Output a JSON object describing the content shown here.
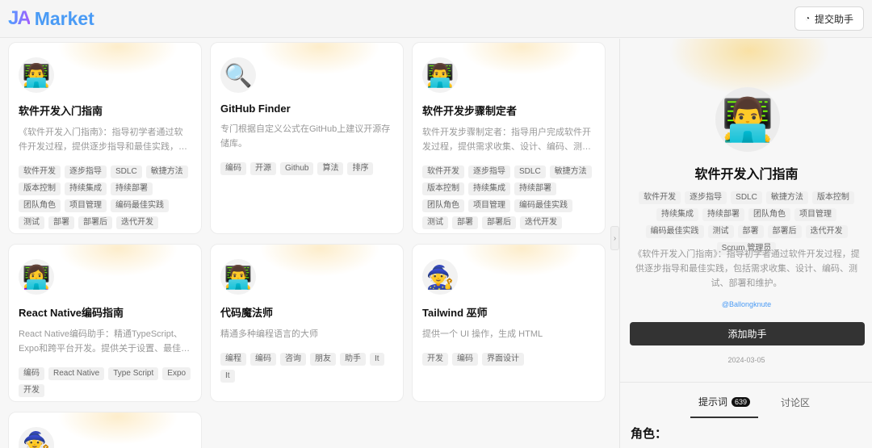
{
  "header": {
    "logo_text": "Market",
    "submit_label": "提交助手"
  },
  "cards": [
    {
      "emoji": "👨‍💻",
      "title": "软件开发入门指南",
      "desc": "《软件开发入门指南》：指导初学者通过软件开发过程，提供逐步指导和最佳实践，包括需求收集、设计、编码、测试、部署和维护。",
      "tags": [
        "软件开发",
        "逐步指导",
        "SDLC",
        "敏捷方法",
        "版本控制",
        "持续集成",
        "持续部署",
        "团队角色",
        "项目管理",
        "编码最佳实践",
        "测试",
        "部署",
        "部署后",
        "迭代开发",
        "Scrum 管理员"
      ]
    },
    {
      "emoji": "🔍",
      "title": "GitHub Finder",
      "desc": "专门根据自定义公式在GitHub上建议开源存储库。",
      "tags": [
        "编码",
        "开源",
        "Github",
        "算法",
        "排序"
      ]
    },
    {
      "emoji": "👨‍💻",
      "title": "软件开发步骤制定者",
      "desc": "软件开发步骤制定者：指导用户完成软件开发过程，提供需求收集、设计、编码、测试等步骤。",
      "tags": [
        "软件开发",
        "逐步指导",
        "SDLC",
        "敏捷方法",
        "版本控制",
        "持续集成",
        "持续部署",
        "团队角色",
        "项目管理",
        "编码最佳实践",
        "测试",
        "部署",
        "部署后",
        "迭代开发"
      ]
    },
    {
      "emoji": "👩‍💻",
      "title": "React Native编码指南",
      "desc": "React Native编码助手：精通TypeScript、Expo和跨平台开发。提供关于设置、最佳实践等方面的帮助。",
      "tags": [
        "编码",
        "React Native",
        "Type Script",
        "Expo",
        "开发"
      ]
    },
    {
      "emoji": "👨‍💻",
      "title": "代码魔法师",
      "desc": "精通多种编程语言的大师",
      "tags": [
        "编程",
        "编码",
        "咨询",
        "朋友",
        "助手",
        "It",
        "It"
      ]
    },
    {
      "emoji": "🧙",
      "title": "Tailwind 巫师",
      "desc": "提供一个 UI 操作，生成 HTML",
      "tags": [
        "开发",
        "编码",
        "界面设计"
      ]
    },
    {
      "emoji": "🧙",
      "title": "",
      "desc": "",
      "tags": []
    }
  ],
  "detail": {
    "emoji": "👨‍💻",
    "title": "软件开发入门指南",
    "tags": [
      "软件开发",
      "逐步指导",
      "SDLC",
      "敏捷方法",
      "版本控制",
      "持续集成",
      "持续部署",
      "团队角色",
      "项目管理",
      "编码最佳实践",
      "测试",
      "部署",
      "部署后",
      "迭代开发",
      "Scrum 管理员"
    ],
    "desc": "《软件开发入门指南》：指导初学者通过软件开发过程，提供逐步指导和最佳实践，包括需求收集、设计、编码、测试、部署和维护。",
    "author": "@Ballongknute",
    "add_label": "添加助手",
    "date": "2024-03-05",
    "tabs": [
      {
        "label": "提示词",
        "count": "639"
      },
      {
        "label": "讨论区"
      }
    ],
    "section_heading": "角色："
  }
}
